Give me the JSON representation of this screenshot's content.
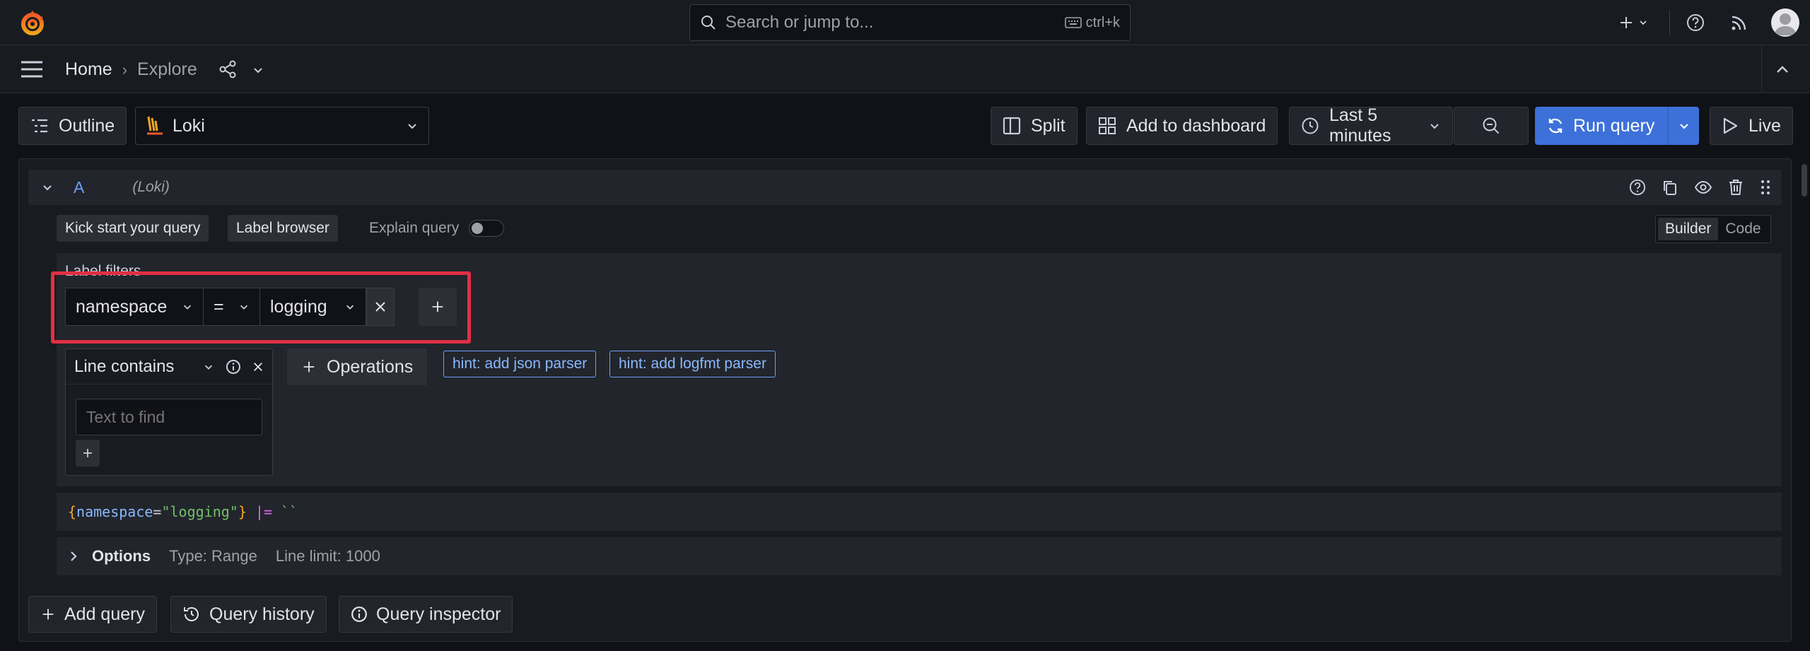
{
  "search": {
    "placeholder": "Search or jump to...",
    "shortcut": "ctrl+k"
  },
  "breadcrumb": {
    "home": "Home",
    "current": "Explore"
  },
  "toolbar": {
    "outline": "Outline",
    "datasource": "Loki",
    "split": "Split",
    "add_to_dashboard": "Add to dashboard",
    "time_range": "Last 5 minutes",
    "run_query": "Run query",
    "live": "Live"
  },
  "query": {
    "ref_id": "A",
    "datasource_tag": "(Loki)",
    "kick_start": "Kick start your query",
    "label_browser": "Label browser",
    "explain_query": "Explain query",
    "mode_builder": "Builder",
    "mode_code": "Code",
    "label_filters_title": "Label filters",
    "filter": {
      "label": "namespace",
      "operator": "=",
      "value": "logging"
    },
    "line_contains": {
      "title": "Line contains",
      "placeholder": "Text to find"
    },
    "operations": "Operations",
    "hints": [
      "hint: add json parser",
      "hint: add logfmt parser"
    ],
    "code": {
      "open": "{",
      "key": "namespace",
      "eq": "=",
      "value": "\"logging\"",
      "close": "}",
      "op": "|=",
      "literal": "``"
    },
    "options": {
      "label": "Options",
      "type": "Type: Range",
      "limit": "Line limit: 1000"
    }
  },
  "footer": {
    "add_query": "Add query",
    "query_history": "Query history",
    "query_inspector": "Query inspector"
  },
  "colors": {
    "accent": "#3d71d9",
    "highlight": "#e02f44",
    "hint": "#6e9fff"
  }
}
